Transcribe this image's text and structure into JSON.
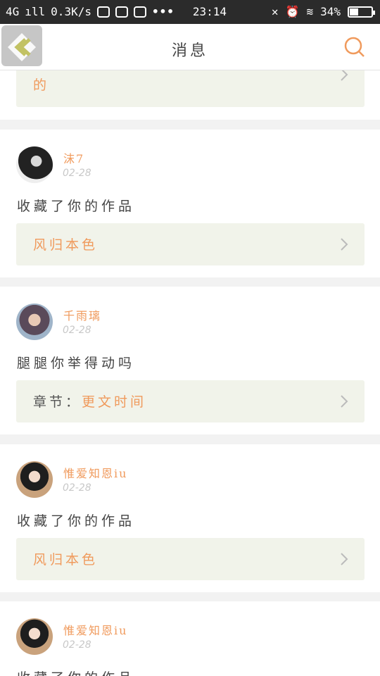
{
  "status_bar": {
    "network": "4G",
    "speed": "0.3K/s",
    "time": "23:14",
    "battery": "34%",
    "battery_level": 0.34
  },
  "header": {
    "title": "消息",
    "back_icon": "back-arrow-icon",
    "search_icon": "search-icon"
  },
  "top_partial": {
    "work_line2": "的"
  },
  "messages": [
    {
      "user": "沫7",
      "date": "02-28",
      "text": "收藏了你的作品",
      "work_prefix": "",
      "work": "风归本色"
    },
    {
      "user": "千雨璃",
      "date": "02-28",
      "text": "腿腿你举得动吗",
      "work_prefix": "章节：",
      "work": "更文时间"
    },
    {
      "user": "惟爱知恩iu",
      "date": "02-28",
      "text": "收藏了你的作品",
      "work_prefix": "",
      "work": "风归本色"
    },
    {
      "user": "惟爱知恩iu",
      "date": "02-28",
      "text": "收藏了你的作品",
      "work_prefix": "",
      "work": ""
    }
  ],
  "colors": {
    "accent": "#f09a5c",
    "work_box_bg": "#f1f3ea",
    "status_bar_bg": "#2b2b2b"
  }
}
